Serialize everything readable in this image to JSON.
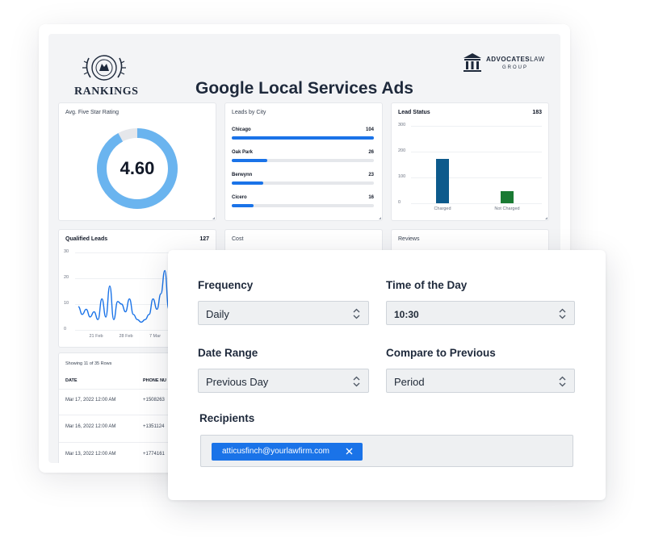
{
  "dashboard": {
    "title": "Google Local Services Ads",
    "brand_logo_text": "RANKINGS",
    "partner_logo": {
      "name_bold": "ADVOCATES",
      "name_light": "LAW",
      "sub": "GROUP",
      "mark": "ALG"
    },
    "rating_panel": {
      "title": "Avg. Five Star Rating",
      "value": "4.60",
      "fraction": 0.92,
      "color": "#6ab4ef"
    },
    "city_panel": {
      "title": "Leads by City",
      "max": 104,
      "items": [
        {
          "name": "Chicago",
          "value": 104
        },
        {
          "name": "Oak Park",
          "value": 26
        },
        {
          "name": "Berwynn",
          "value": 23
        },
        {
          "name": "Cicero",
          "value": 16
        }
      ]
    },
    "status_panel": {
      "title": "Lead Status",
      "total": "183",
      "y_ticks": [
        "300",
        "200",
        "100",
        "0"
      ],
      "bars": [
        {
          "label": "Charged",
          "value": 172,
          "color": "#0d5a8c"
        },
        {
          "label": "Not Charged",
          "value": 48,
          "color": "#1a7a33"
        }
      ],
      "y_max": 300
    },
    "qualified_panel": {
      "title": "Qualified Leads",
      "total": "127",
      "y_ticks": [
        "30",
        "20",
        "10",
        "0"
      ],
      "x_ticks": [
        "21 Feb",
        "28 Feb",
        "7 Mar"
      ]
    },
    "cost_panel": {
      "title": "Cost"
    },
    "reviews_panel": {
      "title": "Reviews"
    },
    "table": {
      "caption": "Showing 11 of 35 Rows",
      "columns": [
        "DATE",
        "PHONE NU"
      ],
      "rows": [
        {
          "date": "Mar 17, 2022 12:00 AM",
          "phone": "+1508263"
        },
        {
          "date": "Mar 16, 2022 12:00 AM",
          "phone": "+1351124"
        },
        {
          "date": "Mar 13, 2022 12:00 AM",
          "phone": "+1774161"
        }
      ]
    }
  },
  "chart_data": [
    {
      "type": "bar",
      "title": "Lead Status",
      "categories": [
        "Charged",
        "Not Charged"
      ],
      "values": [
        172,
        48
      ],
      "ylim": [
        0,
        300
      ]
    },
    {
      "type": "line",
      "title": "Qualified Leads",
      "x": [
        "Feb 14",
        "Feb 15",
        "Feb 16",
        "Feb 17",
        "Feb 18",
        "Feb 19",
        "Feb 20",
        "Feb 21",
        "Feb 22",
        "Feb 23",
        "Feb 24",
        "Feb 25",
        "Feb 26",
        "Feb 27",
        "Feb 28",
        "Mar 1",
        "Mar 2",
        "Mar 3",
        "Mar 4",
        "Mar 5",
        "Mar 6",
        "Mar 7",
        "Mar 8",
        "Mar 9"
      ],
      "values": [
        9,
        6,
        8,
        5,
        7,
        4,
        12,
        5,
        17,
        4,
        11,
        10,
        7,
        12,
        6,
        4,
        3,
        4,
        6,
        12,
        8,
        14,
        23,
        8
      ],
      "ylim": [
        0,
        30
      ]
    }
  ],
  "settings": {
    "frequency": {
      "label": "Frequency",
      "value": "Daily"
    },
    "time_of_day": {
      "label": "Time of the Day",
      "value": "10:30"
    },
    "date_range": {
      "label": "Date Range",
      "value": "Previous Day"
    },
    "compare": {
      "label": "Compare to Previous",
      "value": "Period"
    },
    "recipients": {
      "label": "Recipients",
      "chips": [
        "atticusfinch@yourlawfirm.com"
      ]
    }
  }
}
